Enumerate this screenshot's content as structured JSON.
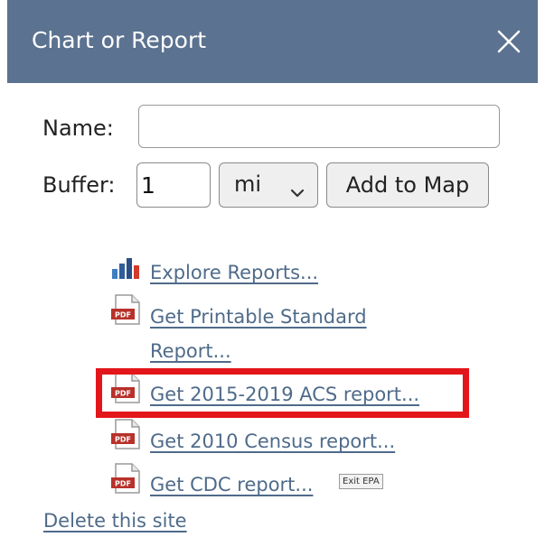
{
  "panel": {
    "title": "Chart or Report",
    "close_icon": "close-icon",
    "header_color": "#5b7290"
  },
  "form": {
    "name_label": "Name:",
    "name_value": "",
    "buffer_label": "Buffer:",
    "buffer_value": "1",
    "unit_value": "mi",
    "add_button_label": "Add to Map"
  },
  "links": {
    "explore_reports": "Explore Reports...",
    "printable_line1": "Get Printable Standard",
    "printable_line2": "Report...",
    "acs_report": "Get 2015-2019 ACS report...",
    "census_report": "Get 2010 Census report...",
    "cdc_report": "Get CDC report...",
    "exit_badge": "Exit EPA",
    "delete_site": "Delete this site",
    "link_color": "#4f6b8a",
    "highlight_color": "#e3161b"
  },
  "icons": {
    "bar_chart": "bar-chart-icon",
    "pdf": "pdf-icon"
  }
}
